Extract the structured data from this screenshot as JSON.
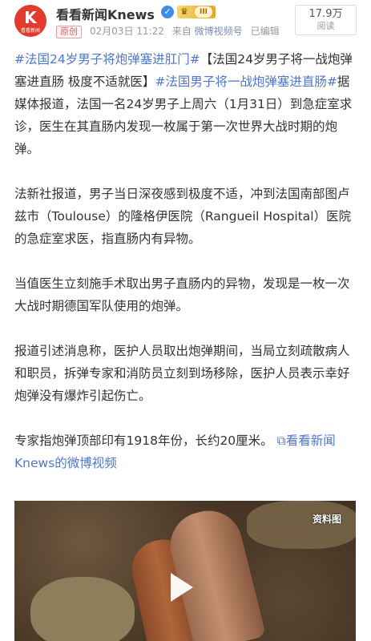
{
  "header": {
    "avatar_text": "K",
    "avatar_sub": "看看新闻",
    "account_name": "看看新闻Knews",
    "verified_icon": "verified-badge-icon",
    "vip_icon": "crown-icon",
    "vip_level": "III",
    "original_tag": "原创",
    "date": "02月03日 11:22",
    "source_prefix": "来自",
    "source_name": "微博视频号",
    "edited": "已编辑",
    "views_count": "17.9万",
    "views_label": "阅读"
  },
  "article": {
    "p1_tag1": "#法国24岁男子将炮弹塞进肛门#",
    "p1_text1": "【法国24岁男子将一战炮弹塞进直肠 极度不适就医】",
    "p1_tag2": "#法国男子将一战炮弹塞进直肠#",
    "p1_text2": "据媒体报道，法国一名24岁男子上周六（1月31日）到急症室求诊，医生在其直肠内发现一枚属于第一次世界大战时期的炮弹。",
    "p2": "法新社报道，男子当日深夜感到极度不适，冲到法国南部图卢兹市（Toulouse）的隆格伊医院（Rangueil Hospital）医院的急症室求医，指直肠内有异物。",
    "p3": "当值医生立刻施手术取出男子直肠内的异物，发现是一枚一次大战时期德国军队使用的炮弹。",
    "p4": "报道引述消息称，医护人员取出炮弹期间，当局立刻疏散病人和职员，拆弹专家和消防员立刻到场移除，医护人员表示幸好炮弹没有爆炸引起伤亡。",
    "p5_text": "专家指炮弹顶部印有1918年份，长约20厘米。",
    "video_link_icon": "video-link-icon",
    "video_link": "看看新闻Knews的微博视频"
  },
  "video": {
    "label": "资料图",
    "play_icon": "play-icon"
  }
}
